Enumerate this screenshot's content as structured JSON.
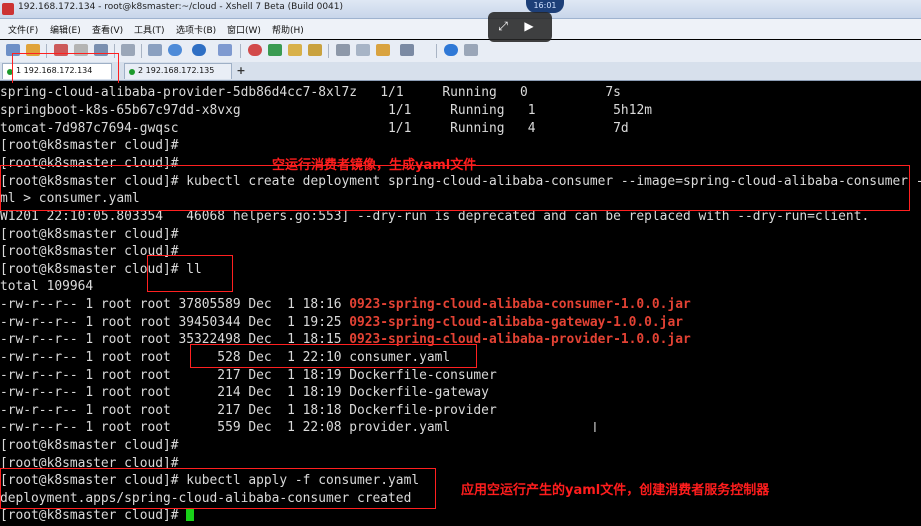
{
  "window": {
    "title": "192.168.172.134 - root@k8smaster:~/cloud - Xshell 7 Beta (Build 0041)"
  },
  "menu": [
    "文件(F)",
    "编辑(E)",
    "查看(V)",
    "工具(T)",
    "选项卡(B)",
    "窗口(W)",
    "帮助(H)"
  ],
  "clock": "16:01",
  "tabs": [
    {
      "label": "1 192.168.172.134"
    },
    {
      "label": "2 192.168.172.135"
    }
  ],
  "add_tab": "+",
  "pods": [
    {
      "name": "spring-cloud-alibaba-provider-5db86d4cc7-8xl7z",
      "ready": "1/1",
      "status": "Running",
      "restarts": "0",
      "age": "7s"
    },
    {
      "name": "springboot-k8s-65b67c97dd-x8vxg",
      "ready": "1/1",
      "status": "Running",
      "restarts": "1",
      "age": "5h12m"
    },
    {
      "name": "tomcat-7d987c7694-gwqsc",
      "ready": "1/1",
      "status": "Running",
      "restarts": "4",
      "age": "7d"
    }
  ],
  "prompt": "[root@k8smaster cloud]#",
  "commands": {
    "create_1": "kubectl create deployment spring-cloud-alibaba-consumer --image=spring-cloud-alibaba-consumer --",
    "create_2": "ml > consumer.yaml",
    "warning": "W1201 22:10:05.803354   46068 helpers.go:553] --dry-run is deprecated and can be replaced with --dry-run=client.",
    "ll": "ll",
    "total": "total 109964",
    "apply": "kubectl apply -f consumer.yaml",
    "apply_out": "deployment.apps/spring-cloud-alibaba-consumer created"
  },
  "files": [
    {
      "meta": "-rw-r--r-- 1 root root 37805589 Dec  1 18:16 ",
      "name": "0923-spring-cloud-alibaba-consumer-1.0.0.jar",
      "jar": true
    },
    {
      "meta": "-rw-r--r-- 1 root root 39450344 Dec  1 19:25 ",
      "name": "0923-spring-cloud-alibaba-gateway-1.0.0.jar",
      "jar": true
    },
    {
      "meta": "-rw-r--r-- 1 root root 35322498 Dec  1 18:15 ",
      "name": "0923-spring-cloud-alibaba-provider-1.0.0.jar",
      "jar": true
    },
    {
      "meta": "-rw-r--r-- 1 root root      528 Dec  1 22:10 ",
      "name": "consumer.yaml",
      "jar": false
    },
    {
      "meta": "-rw-r--r-- 1 root root      217 Dec  1 18:19 ",
      "name": "Dockerfile-consumer",
      "jar": false
    },
    {
      "meta": "-rw-r--r-- 1 root root      214 Dec  1 18:19 ",
      "name": "Dockerfile-gateway",
      "jar": false
    },
    {
      "meta": "-rw-r--r-- 1 root root      217 Dec  1 18:18 ",
      "name": "Dockerfile-provider",
      "jar": false
    },
    {
      "meta": "-rw-r--r-- 1 root root      559 Dec  1 22:08 ",
      "name": "provider.yaml",
      "jar": false
    }
  ],
  "annotations": {
    "dry_run": "空运行消费者镜像，生成yaml文件",
    "apply": "应用空运行产生的yaml文件，创建消费者服务控制器"
  },
  "colors": {
    "annotation": "#ff1d1d",
    "jar_file": "#e34234",
    "cursor": "#19d219"
  }
}
